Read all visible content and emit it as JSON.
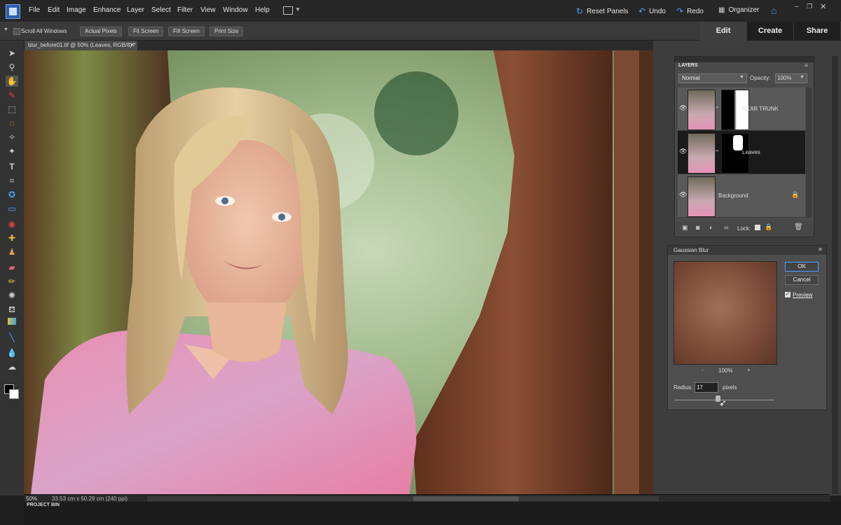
{
  "menubar": {
    "items": [
      "File",
      "Edit",
      "Image",
      "Enhance",
      "Layer",
      "Select",
      "Filter",
      "View",
      "Window",
      "Help"
    ],
    "reset_panels": "Reset Panels",
    "undo": "Undo",
    "redo": "Redo",
    "organizer": "Organizer"
  },
  "options": {
    "scroll_all_windows": "Scroll All Windows",
    "buttons": [
      "Actual Pixels",
      "Fit Screen",
      "Fill Screen",
      "Print Size"
    ]
  },
  "modes": {
    "edit": "Edit",
    "create": "Create",
    "share": "Share"
  },
  "document": {
    "tab_title": "blur_before01.tif @ 50% (Leaves, RGB/8) *"
  },
  "layers_panel": {
    "title": "LAYERS",
    "blend_mode": "Normal",
    "opacity_label": "Opacity:",
    "opacity_value": "100%",
    "layers": [
      {
        "name": "REAR TRUNK"
      },
      {
        "name": "Leaves"
      },
      {
        "name": "Background"
      }
    ],
    "lock_label": "Lock:"
  },
  "gaussian_blur": {
    "title": "Gaussian Blur",
    "ok": "OK",
    "cancel": "Cancel",
    "preview": "Preview",
    "zoom": "100%",
    "radius_label": "Radius:",
    "radius_value": "17",
    "radius_unit": "pixels"
  },
  "status": {
    "zoom": "50%",
    "doc_size": "33.53 cm x 50.29 cm (240 ppi)"
  },
  "project_bin": {
    "label": "PROJECT BIN"
  },
  "colors": {
    "accent": "#4aa0ff",
    "chrome": "#262626"
  }
}
